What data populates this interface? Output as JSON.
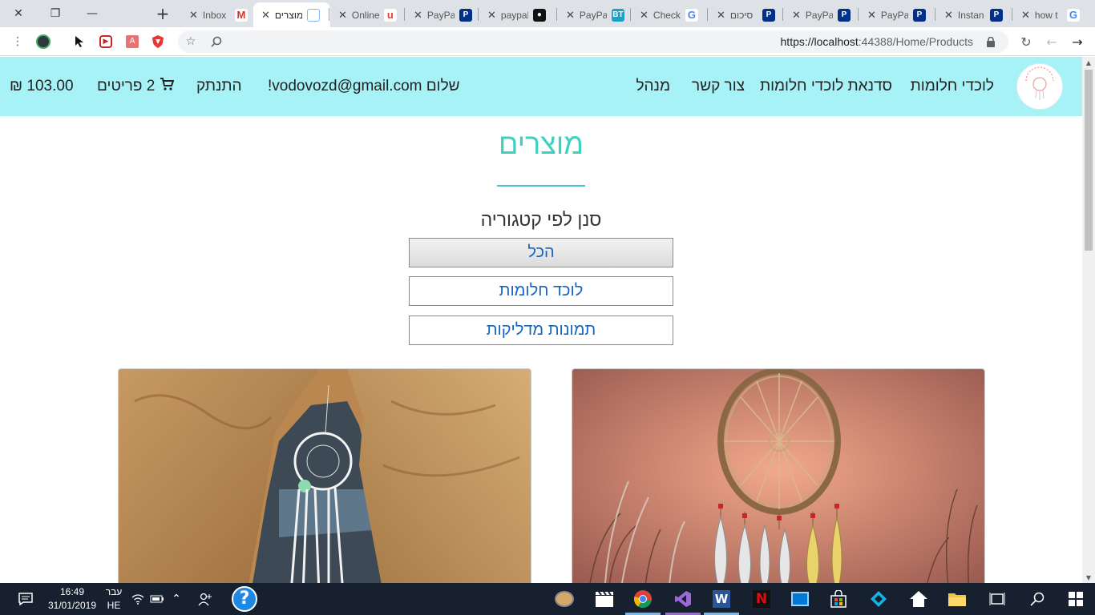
{
  "browser": {
    "tabs": [
      {
        "title": "Inbox",
        "icon": "gmail-icon",
        "color": "#d93025",
        "glyph": "M"
      },
      {
        "title": "מוצרים",
        "icon": "page-icon",
        "color": "#8ab4f8",
        "glyph": "",
        "active": true
      },
      {
        "title": "Online",
        "icon": "u-icon",
        "color": "#e53935",
        "glyph": "u"
      },
      {
        "title": "PayPal",
        "icon": "paypal-icon",
        "color": "#003087",
        "glyph": "P"
      },
      {
        "title": "paypal",
        "icon": "github-icon",
        "color": "#111111",
        "glyph": "●"
      },
      {
        "title": "PayPal",
        "icon": "bt-icon",
        "color": "#1aa1c9",
        "glyph": "BT"
      },
      {
        "title": "Check",
        "icon": "google-icon",
        "color": "#4285f4",
        "glyph": "G"
      },
      {
        "title": "סיכום",
        "icon": "paypal-icon",
        "color": "#003087",
        "glyph": "P"
      },
      {
        "title": "PayPal",
        "icon": "paypal-icon",
        "color": "#003087",
        "glyph": "P"
      },
      {
        "title": "PayPal",
        "icon": "paypal-icon",
        "color": "#003087",
        "glyph": "P"
      },
      {
        "title": "Instan",
        "icon": "paypal-icon",
        "color": "#003087",
        "glyph": "P"
      },
      {
        "title": "how t",
        "icon": "google-icon",
        "color": "#4285f4",
        "glyph": "G"
      }
    ],
    "new_tab": "+",
    "url_host": "https://localhost",
    "url_rest": ":44388/Home/Products"
  },
  "site": {
    "nav": {
      "dreamcatchers": "לוכדי חלומות",
      "workshop": "סדנאת לוכדי חלומות",
      "contact": "צור קשר",
      "admin": "מנהל"
    },
    "greeting": "שלום vodovozd@gmail.com!",
    "logout": "התנתק",
    "cart_count": "2 פריטים",
    "cart_total": "103.00 ₪"
  },
  "products_page": {
    "title": "מוצרים",
    "filter_heading": "סנן לפי קטגוריה",
    "categories": [
      {
        "label": "הכל",
        "selected": true
      },
      {
        "label": "לוכד חלומות",
        "selected": false
      },
      {
        "label": "תמונות מדליקות",
        "selected": false
      }
    ]
  },
  "taskbar": {
    "time": "16:49",
    "date": "31/01/2019",
    "lang_top": "עבר",
    "lang_bottom": "HE"
  },
  "colors": {
    "header_bg": "#a6f2f7",
    "title_teal": "#3fd0c0",
    "link_blue": "#1565c0"
  }
}
